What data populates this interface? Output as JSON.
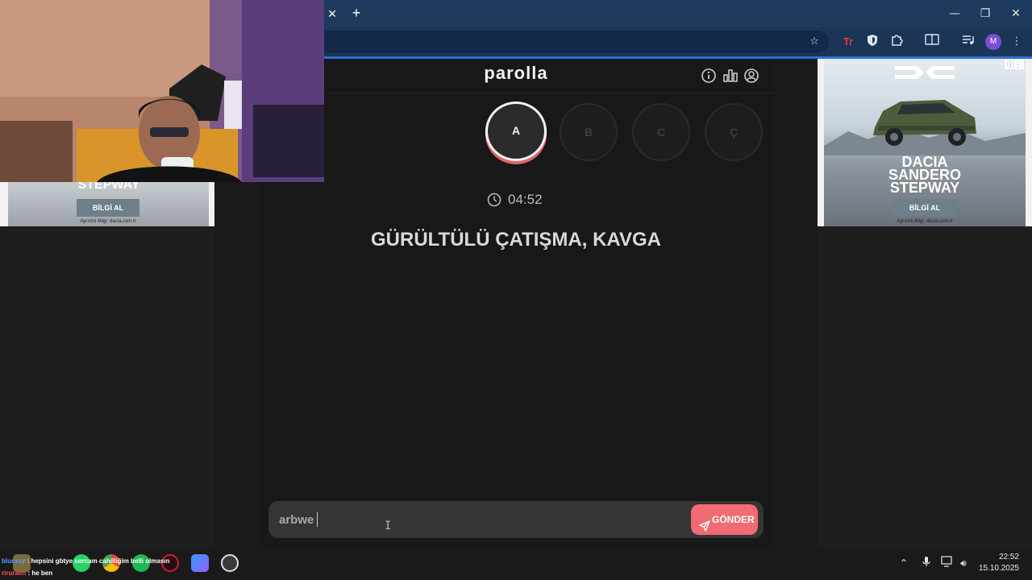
{
  "browser": {
    "close_tab_glyph": "✕",
    "new_tab_glyph": "+",
    "window_controls": {
      "minimize": "—",
      "maximize": "❐",
      "close": "✕"
    },
    "toolbar_icons": [
      "star-icon",
      "extension-red-icon",
      "shield-icon",
      "puzzle-icon",
      "reading-list-icon",
      "media-control-icon",
      "profile-icon",
      "menu-icon"
    ],
    "profile_initial": "M"
  },
  "app": {
    "title": "parolla",
    "header_icons": [
      "info-icon",
      "stats-icon",
      "account-icon"
    ],
    "letters": [
      {
        "label": "A",
        "state": "active"
      },
      {
        "label": "B",
        "state": "inactive"
      },
      {
        "label": "C",
        "state": "inactive"
      },
      {
        "label": "Ç",
        "state": "inactive"
      }
    ],
    "timer": "04:52",
    "clue": "GÜRÜLTÜLÜ ÇATIŞMA, KAVGA",
    "answer_value": "arbwe",
    "send_label": "GÖNDER",
    "colors": {
      "accent": "#f26a72",
      "background": "#181818",
      "panel": "#353535"
    }
  },
  "ads": {
    "left": {
      "title": "STEPWAY",
      "button": "BİLGİ AL",
      "footnote": "Ayrıntılı Bilgi: dacia.com.tr"
    },
    "right": {
      "brand_lines": [
        "DACIA",
        "SANDERO",
        "STEPWAY"
      ],
      "button": "BİLGİ AL",
      "footnote": "Ayrıntılı Bilgi: dacia.com.tr"
    }
  },
  "stream_chat": [
    {
      "user": "blucezy",
      "message": ": hepsini gbtye sorcam cahilliğim belli olmasın"
    },
    {
      "user": "riruraen",
      "message": ": he ben"
    }
  ],
  "taskbar": {
    "apps": [
      "explorer-icon",
      "whatsapp-icon",
      "chrome-icon",
      "spotify-icon",
      "opera-gx-icon",
      "dev-app-icon",
      "obs-icon"
    ],
    "time": "22:52",
    "date": "15.10.2025"
  }
}
